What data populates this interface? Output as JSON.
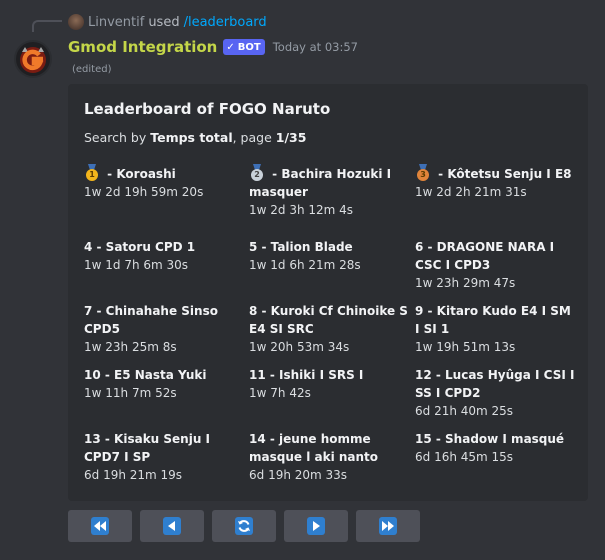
{
  "reply": {
    "username": "Linventif",
    "action": "used",
    "command": "/leaderboard"
  },
  "message": {
    "author": "Gmod Integration",
    "bot_badge": "BOT",
    "timestamp": "Today at 03:57",
    "edited": "(edited)"
  },
  "embed": {
    "title": "Leaderboard of FOGO  Naruto",
    "desc_prefix": "Search by ",
    "desc_sort": "Temps total",
    "desc_mid": ", page ",
    "desc_page": "1/35",
    "entries": [
      {
        "rank": "1",
        "medal": "gold",
        "name": " - Koroashi",
        "time": "1w 2d 19h 59m 20s"
      },
      {
        "rank": "2",
        "medal": "silver",
        "name": " - Bachira Hozuki I masquer",
        "time": "1w 2d 3h 12m 4s"
      },
      {
        "rank": "3",
        "medal": "bronze",
        "name": " - Kôtetsu Senju I E8",
        "time": "1w 2d 2h 21m 31s"
      },
      {
        "rank": "4",
        "name": "4 - Satoru CPD 1",
        "time": "1w 1d 7h 6m 30s"
      },
      {
        "rank": "5",
        "name": "5 - Talion Blade",
        "time": "1w 1d 6h 21m 28s"
      },
      {
        "rank": "6",
        "name": "6 - DRAGONE NARA I CSC I CPD3",
        "time": "1w 23h 29m 47s"
      },
      {
        "rank": "7",
        "name": "7 - Chinahahe Sinso CPD5",
        "time": "1w 23h 25m 8s"
      },
      {
        "rank": "8",
        "name": "8 - Kuroki Cf Chinoike S E4 SI SRC",
        "time": "1w 20h 53m 34s"
      },
      {
        "rank": "9",
        "name": "9 - Kitaro Kudo E4 I SM I SI 1",
        "time": "1w 19h 51m 13s"
      },
      {
        "rank": "10",
        "name": "10 - E5  Nasta Yuki",
        "time": "1w 11h 7m 52s"
      },
      {
        "rank": "11",
        "name": "11 - Ishiki I SRS I",
        "time": "1w 7h 42s"
      },
      {
        "rank": "12",
        "name": "12 - Lucas Hyûga I CSI I SS I CPD2",
        "time": "6d 21h 40m 25s"
      },
      {
        "rank": "13",
        "name": "13 - Kisaku Senju I CPD7 I SP",
        "time": "6d 19h 21m 19s"
      },
      {
        "rank": "14",
        "name": "14 - jeune homme masque l aki nanto",
        "time": "6d 19h 20m 33s"
      },
      {
        "rank": "15",
        "name": "15 - Shadow I masqué",
        "time": "6d 16h 45m 15s"
      }
    ]
  },
  "buttons": [
    {
      "icon": "rewind-icon"
    },
    {
      "icon": "previous-icon"
    },
    {
      "icon": "refresh-icon"
    },
    {
      "icon": "next-icon"
    },
    {
      "icon": "fast-forward-icon"
    }
  ],
  "colors": {
    "background": "#313338",
    "embed": "#2b2d31",
    "author": "#c4d649",
    "link": "#00a8fc",
    "bot_badge": "#5865f2",
    "button": "#4e5058",
    "button_icon": "#2f7fcf"
  }
}
